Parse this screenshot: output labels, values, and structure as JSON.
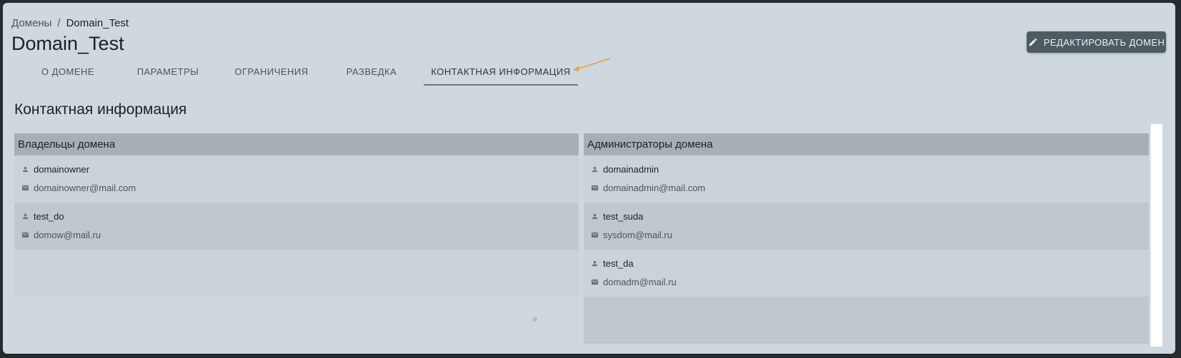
{
  "breadcrumb": {
    "parent": "Домены",
    "separator": "/",
    "current": "Domain_Test"
  },
  "page": {
    "title": "Domain_Test",
    "section_title": "Контактная информация"
  },
  "actions": {
    "edit_label": "РЕДАКТИРОВАТЬ ДОМЕН",
    "edit_icon": "pencil-icon"
  },
  "tabs": [
    {
      "label": "О ДОМЕНЕ"
    },
    {
      "label": "ПАРАМЕТРЫ"
    },
    {
      "label": "ОГРАНИЧЕНИЯ"
    },
    {
      "label": "РАЗВЕДКА"
    },
    {
      "label": "КОНТАКТНАЯ ИНФОРМАЦИЯ",
      "active": true
    }
  ],
  "owners": {
    "title": "Владельцы домена",
    "items": [
      {
        "name": "domainowner",
        "email": "domainowner@mail.com"
      },
      {
        "name": "test_do",
        "email": "domow@mail.ru"
      }
    ]
  },
  "admins": {
    "title": "Администраторы домена",
    "items": [
      {
        "name": "domainadmin",
        "email": "domainadmin@mail.com"
      },
      {
        "name": "test_suda",
        "email": "sysdom@mail.ru"
      },
      {
        "name": "test_da",
        "email": "domadm@mail.ru"
      }
    ]
  },
  "colors": {
    "background": "#ced8de",
    "header": "#a5afb4",
    "button": "#4f5b63",
    "arrow": "#e8a040"
  }
}
